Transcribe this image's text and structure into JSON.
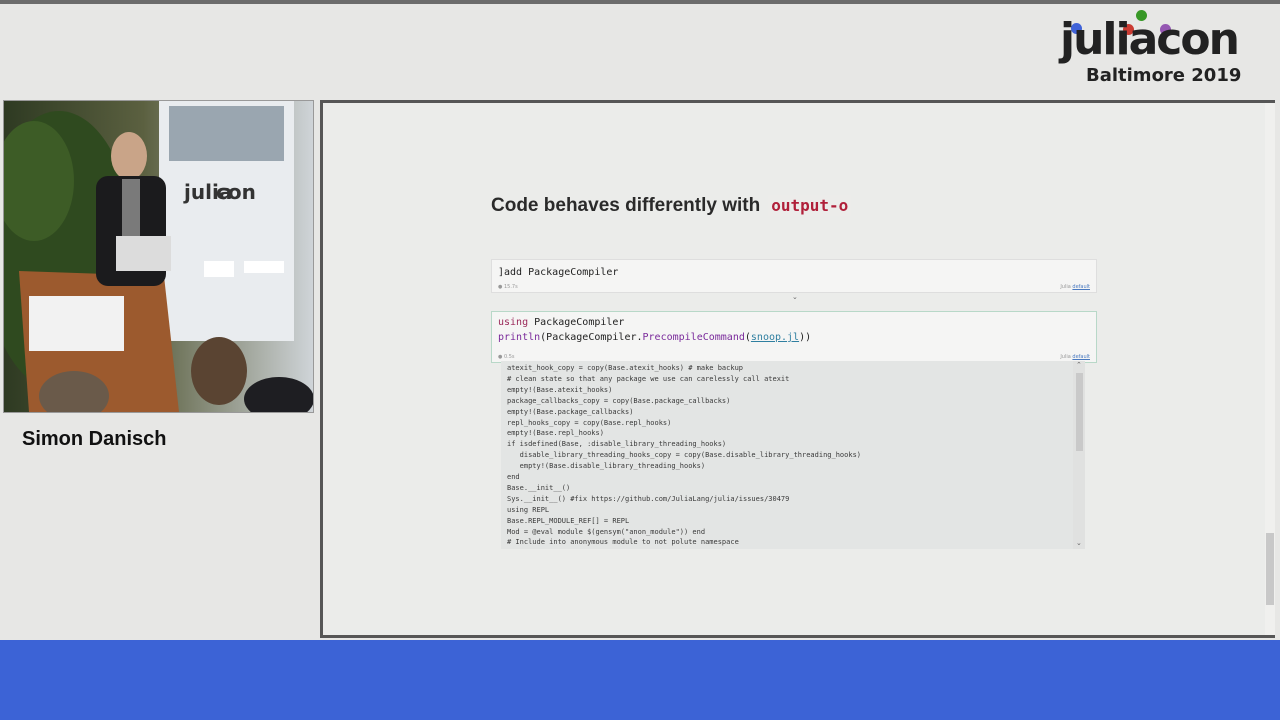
{
  "event": {
    "logo_word": "juliacon",
    "logo_subtitle": "Baltimore 2019",
    "dot_colors": [
      "#4063d8",
      "#389826",
      "#9558b2",
      "#cb3c33"
    ]
  },
  "speaker": {
    "name": "Simon Danisch"
  },
  "slide": {
    "title": "Code behaves differently with",
    "title_code": "output-o",
    "cell1": {
      "code": "]add PackageCompiler",
      "timing": "15.7s",
      "lang": "Julia",
      "lang_link": "default"
    },
    "cell2": {
      "line1_kw": "using",
      "line1_rest": " PackageCompiler",
      "line2_fn": "println",
      "line2_mid": "(PackageCompiler.",
      "line2_fn2": "PrecompileCommand",
      "line2_open": "(",
      "line2_str": "snoop.jl",
      "line2_close": "))",
      "timing": "0.5s",
      "lang": "Julia",
      "lang_link": "default"
    },
    "output_lines": [
      "atexit_hook_copy = copy(Base.atexit_hooks) # make backup",
      "# clean state so that any package we use can carelessly call atexit",
      "empty!(Base.atexit_hooks)",
      "package_callbacks_copy = copy(Base.package_callbacks)",
      "empty!(Base.package_callbacks)",
      "repl_hooks_copy = copy(Base.repl_hooks)",
      "empty!(Base.repl_hooks)",
      "if isdefined(Base, :disable_library_threading_hooks)",
      "   disable_library_threading_hooks_copy = copy(Base.disable_library_threading_hooks)",
      "   empty!(Base.disable_library_threading_hooks)",
      "end",
      "Base.__init__()",
      "Sys.__init__() #fix https://github.com/JuliaLang/julia/issues/30479",
      "using REPL",
      "Base.REPL_MODULE_REF[] = REPL",
      "Mod = @eval module $(gensym(\"anon_module\")) end",
      "# Include into anonymous module to not polute namespace"
    ]
  }
}
